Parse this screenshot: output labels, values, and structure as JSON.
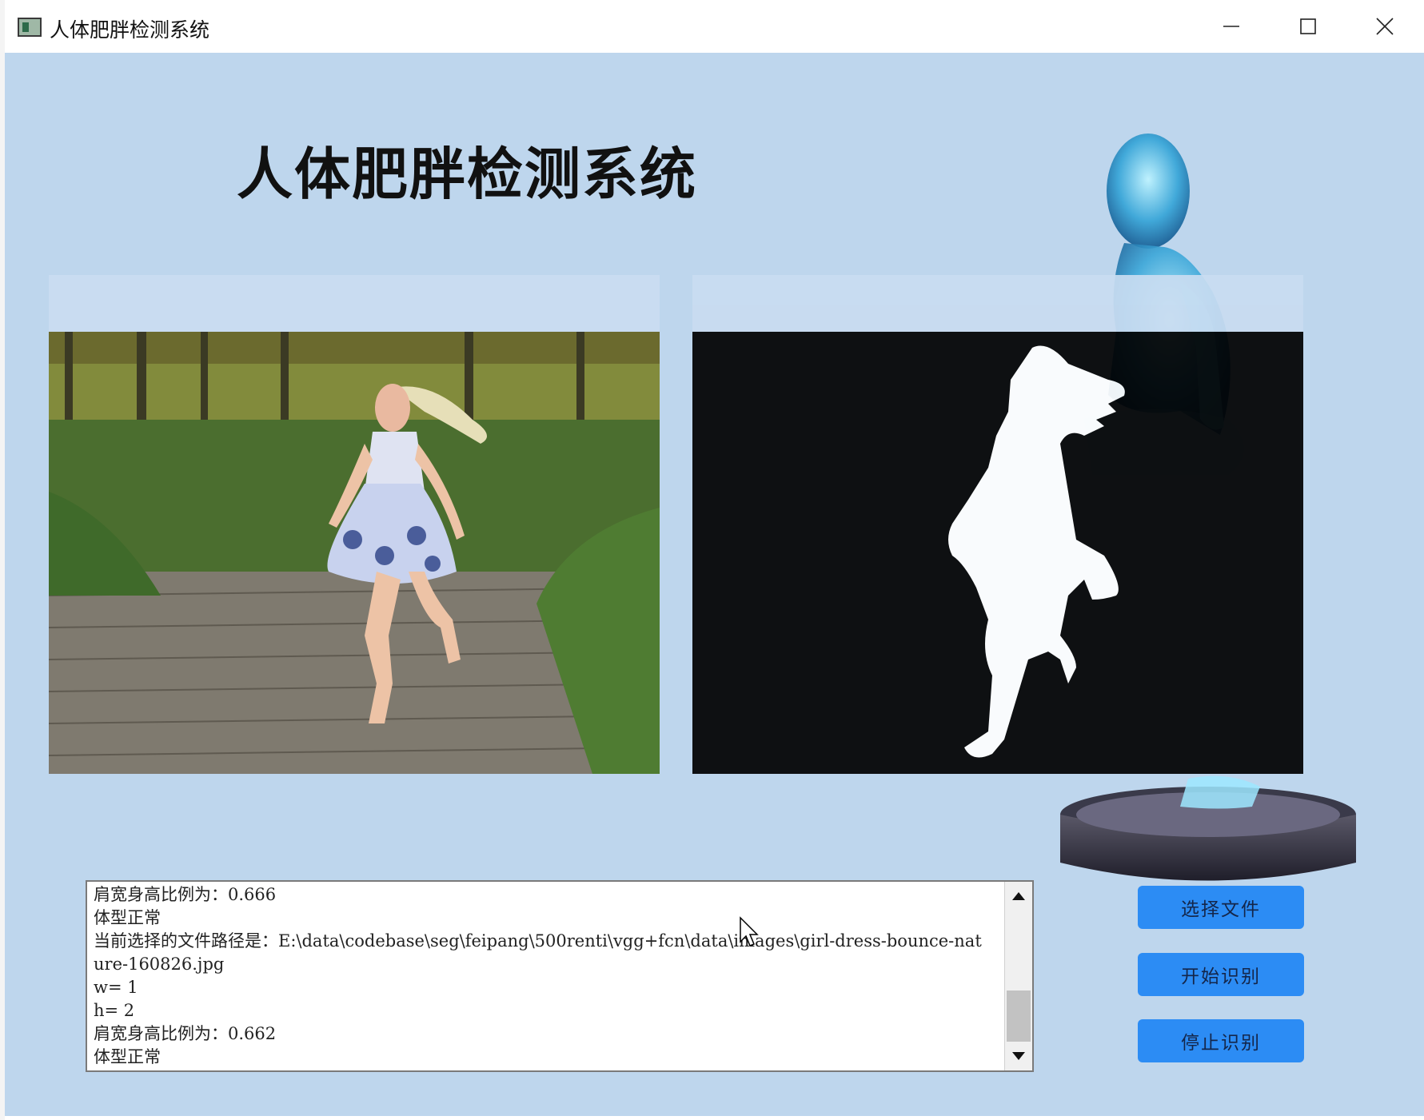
{
  "window": {
    "title": "人体肥胖检测系统",
    "controls": [
      "minimize",
      "maximize",
      "close"
    ]
  },
  "app": {
    "heading": "人体肥胖检测系统"
  },
  "images": {
    "original": "girl dancing photo",
    "segmentation": "silhouette mask"
  },
  "log": {
    "lines": "肩宽身高比例为：0.666\n体型正常\n当前选择的文件路径是：E:\\data\\codebase\\seg\\feipang\\500renti\\vgg+fcn\\data\\images\\girl-dress-bounce-nature-160826.jpg\nw= 1\nh= 2\n肩宽身高比例为：0.662\n体型正常"
  },
  "buttons": {
    "select_file": "选择文件",
    "start_detect": "开始识别",
    "stop_detect": "停止识别"
  },
  "colors": {
    "background": "#bed6ed",
    "panel": "#c9dcf1",
    "button": "#2c8cf4"
  }
}
